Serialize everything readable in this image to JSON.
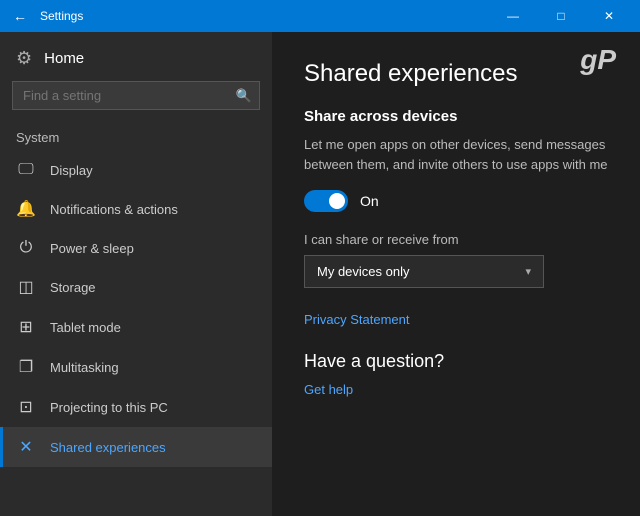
{
  "titleBar": {
    "title": "Settings",
    "backLabel": "←",
    "minimizeLabel": "—",
    "maximizeLabel": "□",
    "closeLabel": "✕"
  },
  "sidebar": {
    "homeLabel": "Home",
    "searchPlaceholder": "Find a setting",
    "searchIcon": "🔍",
    "systemLabel": "System",
    "navItems": [
      {
        "id": "display",
        "icon": "🖥",
        "label": "Display"
      },
      {
        "id": "notifications",
        "icon": "🔔",
        "label": "Notifications & actions"
      },
      {
        "id": "power",
        "icon": "⏻",
        "label": "Power & sleep"
      },
      {
        "id": "storage",
        "icon": "💾",
        "label": "Storage"
      },
      {
        "id": "tablet",
        "icon": "⊞",
        "label": "Tablet mode"
      },
      {
        "id": "multitasking",
        "icon": "❐",
        "label": "Multitasking"
      },
      {
        "id": "projecting",
        "icon": "⊡",
        "label": "Projecting to this PC"
      },
      {
        "id": "shared",
        "icon": "✕",
        "label": "Shared experiences",
        "active": true
      }
    ]
  },
  "content": {
    "gpLogo": "gP",
    "pageTitle": "Shared experiences",
    "sectionTitle": "Share across devices",
    "description": "Let me open apps on other devices, send messages between them, and invite others to use apps with me",
    "toggleLabel": "On",
    "shareFromLabel": "I can share or receive from",
    "dropdownValue": "My devices only",
    "privacyLink": "Privacy Statement",
    "haveQuestion": "Have a question?",
    "getHelpLink": "Get help"
  }
}
